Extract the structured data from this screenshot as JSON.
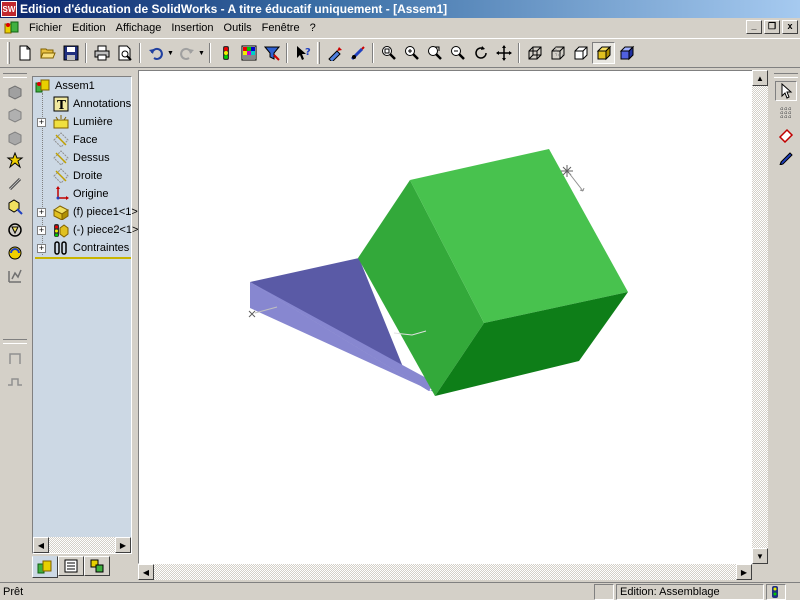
{
  "window": {
    "logo_text": "SW",
    "title": "Edition d'éducation de SolidWorks - A titre éducatif uniquement - [Assem1]"
  },
  "menu": {
    "items": [
      "Fichier",
      "Edition",
      "Affichage",
      "Insertion",
      "Outils",
      "Fenêtre",
      "?"
    ],
    "mdi_min": "_",
    "mdi_restore": "❐",
    "mdi_close": "x"
  },
  "toolbar": {
    "buttons": [
      "new-icon",
      "open-icon",
      "save-icon",
      "print-icon",
      "print-preview-icon",
      "undo-icon",
      "redo-icon",
      "rebuild-icon",
      "options-icon",
      "select-filter-icon",
      "whats-this-icon",
      "sketch-icon",
      "smart-dimension-icon",
      "zoom-to-fit-icon",
      "zoom-area-icon",
      "zoom-in-out-icon",
      "zoom-selection-icon",
      "rotate-view-icon",
      "pan-icon",
      "wireframe-icon",
      "hidden-lines-visible-icon",
      "hidden-lines-removed-icon",
      "shaded-icon",
      "shaded-edges-icon"
    ]
  },
  "tree": {
    "root": "Assem1",
    "items": [
      {
        "label": "Annotations",
        "icon": "annotations-icon",
        "expandable": false
      },
      {
        "label": "Lumière",
        "icon": "lighting-icon",
        "expandable": true
      },
      {
        "label": "Face",
        "icon": "plane-icon",
        "expandable": false
      },
      {
        "label": "Dessus",
        "icon": "plane-icon",
        "expandable": false
      },
      {
        "label": "Droite",
        "icon": "plane-icon",
        "expandable": false
      },
      {
        "label": "Origine",
        "icon": "origin-icon",
        "expandable": false
      },
      {
        "label": "(f) piece1<1>",
        "icon": "part-icon",
        "expandable": true
      },
      {
        "label": "(-) piece2<1>",
        "icon": "part-icon",
        "expandable": true
      },
      {
        "label": "Contraintes",
        "icon": "mates-icon",
        "expandable": true
      }
    ],
    "tabs": [
      "featuremanager-tab",
      "propertymanager-tab",
      "configurationmanager-tab"
    ]
  },
  "status": {
    "text": "Prêt",
    "mode": "Edition: Assemblage"
  },
  "colors": {
    "plate_top": "#5a5aa6",
    "plate_front": "#8787d0",
    "cube_top": "#48c24e",
    "cube_left": "#33a93a",
    "cube_front": "#0e7e18",
    "tree_bg": "#ccd8e4"
  }
}
